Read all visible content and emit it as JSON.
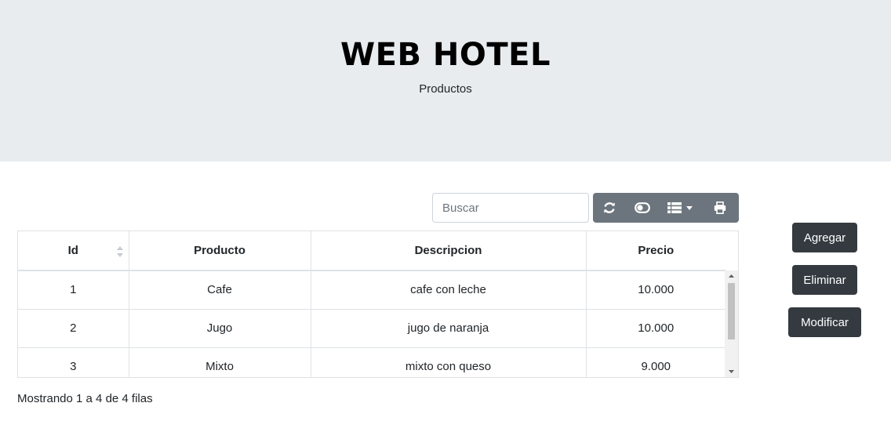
{
  "header": {
    "title": "WEB HOTEL",
    "subtitle": "Productos"
  },
  "search": {
    "placeholder": "Buscar",
    "value": ""
  },
  "toolbar": {
    "buttons": [
      {
        "icon": "refresh-icon"
      },
      {
        "icon": "toggle-icon"
      },
      {
        "icon": "columns-icon"
      },
      {
        "icon": "print-icon"
      }
    ],
    "color": "#6c757d"
  },
  "table": {
    "columns": [
      "Id",
      "Producto",
      "Descripcion",
      "Precio"
    ],
    "rows": [
      {
        "id": "1",
        "producto": "Cafe",
        "descripcion": "cafe con leche",
        "precio": "10.000"
      },
      {
        "id": "2",
        "producto": "Jugo",
        "descripcion": "jugo de naranja",
        "precio": "10.000"
      },
      {
        "id": "3",
        "producto": "Mixto",
        "descripcion": "mixto con queso",
        "precio": "9.000"
      }
    ]
  },
  "actions": {
    "add": "Agregar",
    "delete": "Eliminar",
    "modify": "Modificar",
    "color": "#343a40"
  },
  "pagination": {
    "info": "Mostrando 1 a 4 de 4 filas"
  }
}
